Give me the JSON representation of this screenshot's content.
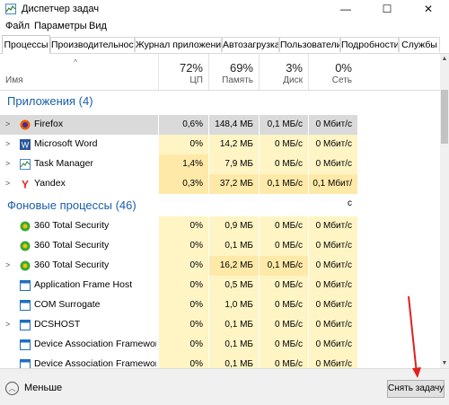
{
  "window": {
    "title": "Диспетчер задач",
    "minimize": "—",
    "maximize": "☐",
    "close": "✕"
  },
  "menu": [
    "Файл",
    "Параметры",
    "Вид"
  ],
  "tabs": [
    "Процессы",
    "Производительность",
    "Журнал приложений",
    "Автозагрузка",
    "Пользователи",
    "Подробности",
    "Службы"
  ],
  "columns": {
    "name": "Имя",
    "cpu": {
      "pct": "72%",
      "label": "ЦП"
    },
    "mem": {
      "pct": "69%",
      "label": "Память"
    },
    "disk": {
      "pct": "3%",
      "label": "Диск"
    },
    "net": {
      "pct": "0%",
      "label": "Сеть"
    }
  },
  "groups": [
    {
      "title": "Приложения (4)",
      "rows": [
        {
          "name": "Firefox",
          "icon": "firefox-icon",
          "expand": true,
          "cpu": "0,6%",
          "mem": "148,4 МБ",
          "disk": "0,1 МБ/с",
          "net": "0 Мбит/с",
          "selected": true
        },
        {
          "name": "Microsoft Word",
          "icon": "word-icon",
          "expand": true,
          "cpu": "0%",
          "mem": "14,2 МБ",
          "disk": "0 МБ/с",
          "net": "0 Мбит/с"
        },
        {
          "name": "Task Manager",
          "icon": "task-manager-icon",
          "expand": true,
          "cpu": "1,4%",
          "mem": "7,9 МБ",
          "disk": "0 МБ/с",
          "net": "0 Мбит/с"
        },
        {
          "name": "Yandex",
          "icon": "yandex-icon",
          "expand": true,
          "cpu": "0,3%",
          "mem": "37,2 МБ",
          "disk": "0,1 МБ/с",
          "net": "0,1 Мбит/с"
        }
      ]
    },
    {
      "title": "Фоновые процессы (46)",
      "rows": [
        {
          "name": "360 Total Security",
          "icon": "360-icon",
          "expand": false,
          "cpu": "0%",
          "mem": "0,9 МБ",
          "disk": "0 МБ/с",
          "net": "0 Мбит/с"
        },
        {
          "name": "360 Total Security",
          "icon": "360-icon",
          "expand": false,
          "cpu": "0%",
          "mem": "0,1 МБ",
          "disk": "0 МБ/с",
          "net": "0 Мбит/с"
        },
        {
          "name": "360 Total Security",
          "icon": "360-icon",
          "expand": true,
          "cpu": "0%",
          "mem": "16,2 МБ",
          "disk": "0,1 МБ/с",
          "net": "0 Мбит/с"
        },
        {
          "name": "Application Frame Host",
          "icon": "app-frame-icon",
          "expand": false,
          "cpu": "0%",
          "mem": "0,5 МБ",
          "disk": "0 МБ/с",
          "net": "0 Мбит/с"
        },
        {
          "name": "COM Surrogate",
          "icon": "com-surrogate-icon",
          "expand": false,
          "cpu": "0%",
          "mem": "1,0 МБ",
          "disk": "0 МБ/с",
          "net": "0 Мбит/с"
        },
        {
          "name": "DCSHOST",
          "icon": "dcshost-icon",
          "expand": true,
          "cpu": "0%",
          "mem": "0,1 МБ",
          "disk": "0 МБ/с",
          "net": "0 Мбит/с"
        },
        {
          "name": "Device Association Framework ...",
          "icon": "device-assoc-icon",
          "expand": false,
          "cpu": "0%",
          "mem": "0,1 МБ",
          "disk": "0 МБ/с",
          "net": "0 Мбит/с"
        },
        {
          "name": "Device Association Framework ...",
          "icon": "device-assoc-icon",
          "expand": false,
          "cpu": "0%",
          "mem": "0,1 МБ",
          "disk": "0 МБ/с",
          "net": "0 Мбит/с"
        }
      ]
    }
  ],
  "footer": {
    "less_label": "Меньше",
    "end_task": "Снять задачу"
  },
  "colors": {
    "accent": "#1a5fa8",
    "heat_light": "#fff4c4",
    "heat_dark": "#ffe9a8",
    "arrow": "#e02020"
  }
}
